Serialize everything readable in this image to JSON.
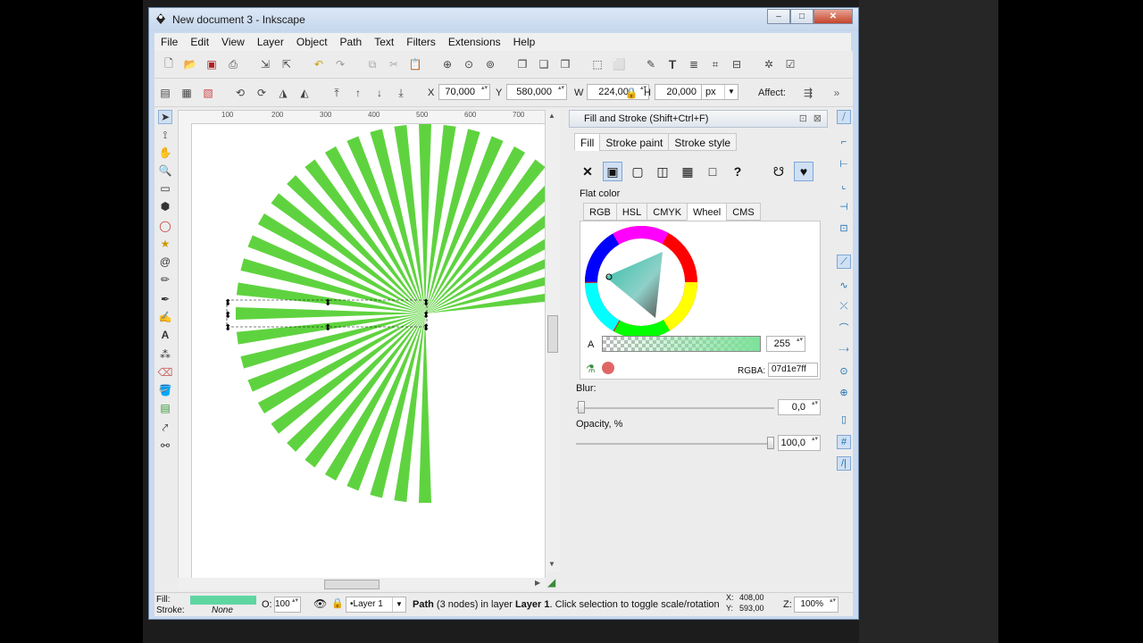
{
  "window": {
    "title": "New document 3 - Inkscape",
    "min": "–",
    "max": "□",
    "close": "✕"
  },
  "menu": [
    "File",
    "Edit",
    "View",
    "Layer",
    "Object",
    "Path",
    "Text",
    "Filters",
    "Extensions",
    "Help"
  ],
  "controls": {
    "x_label": "X",
    "x": "70,000",
    "y_label": "Y",
    "y": "580,000",
    "w_label": "W",
    "w": "224,000",
    "h_label": "H",
    "h": "20,000",
    "unit": "px",
    "affect_label": "Affect:"
  },
  "ruler": [
    "100",
    "200",
    "300",
    "400",
    "500",
    "600",
    "700"
  ],
  "panel": {
    "title": "Fill and Stroke (Shift+Ctrl+F)",
    "tabs": [
      "Fill",
      "Stroke paint",
      "Stroke style"
    ],
    "flat_color_label": "Flat color",
    "subtabs": [
      "RGB",
      "HSL",
      "CMYK",
      "Wheel",
      "CMS"
    ],
    "alpha_label": "A",
    "alpha_value": "255",
    "rgba_label": "RGBA:",
    "rgba_value": "07d1e7ff",
    "blur_label": "Blur:",
    "blur_value": "0,0",
    "opacity_label": "Opacity, %",
    "opacity_value": "100,0"
  },
  "status": {
    "fill_label": "Fill:",
    "stroke_label": "Stroke:",
    "stroke_value": "None",
    "opacity_label": "O:",
    "opacity_value": "100",
    "layer": "•Layer 1",
    "message_prefix": "Path",
    "message_mid": " (3 nodes) in layer ",
    "message_layer": "Layer 1",
    "message_suffix": ". Click selection to toggle scale/rotation",
    "x_coord": "408,00",
    "y_coord": "593,00",
    "x_label": "X:",
    "y_label": "Y:",
    "zoom_label": "Z:",
    "zoom": "100%"
  },
  "colors": {
    "ray": "#5fd33f",
    "fill_swatch": "#5ed6a2",
    "selection": "#000000"
  }
}
